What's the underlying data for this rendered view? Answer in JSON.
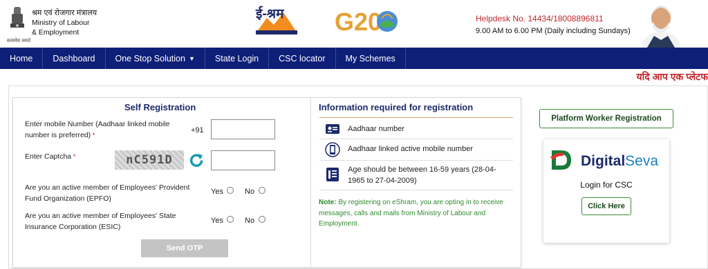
{
  "header": {
    "ministry_hindi": "श्रम एवं रोजगार मंत्रालय",
    "ministry_line1": "Ministry of Labour",
    "ministry_line2": "& Employment",
    "emblem_caption": "सत्यमेव जयते",
    "eshram_text": "ई-श्रम",
    "g20_text": "G20",
    "helpdesk": "Helpdesk No. 14434/18008896811",
    "hours": "9.00 AM to 6.00 PM (Daily including Sundays)"
  },
  "nav": {
    "items": [
      {
        "label": "Home"
      },
      {
        "label": "Dashboard"
      },
      {
        "label": "One Stop Solution",
        "has_caret": true
      },
      {
        "label": "State Login"
      },
      {
        "label": "CSC locator"
      },
      {
        "label": "My Schemes"
      }
    ]
  },
  "marquee": "यदि आप एक प्लेटफ",
  "self_registration": {
    "title": "Self Registration",
    "mobile_label": "Enter mobile Number (Aadhaar linked mobile number is preferred)",
    "mobile_prefix": "+91",
    "mobile_value": "",
    "captcha_label": "Enter Captcha",
    "captcha_text": "nC591D",
    "captcha_value": "",
    "epfo_question": "Are you an active member of Employees' Provident Fund Organization (EPFO)",
    "esic_question": "Are you an active member of Employees' State Insurance Corporation (ESIC)",
    "yes_label": "Yes",
    "no_label": "No",
    "send_otp": "Send OTP"
  },
  "info": {
    "title": "Information required for registration",
    "items": [
      {
        "icon": "id-card-icon",
        "text": "Aadhaar number"
      },
      {
        "icon": "mobile-phone-icon",
        "text": "Aadhaar linked active mobile number"
      },
      {
        "icon": "document-icon",
        "text": "Age should be between 16-59 years (28-04-1965 to 27-04-2009)"
      }
    ],
    "note_label": "Note:",
    "note_text": "By registering on eShram, you are opting in to receive messages, calls and mails from Ministry of Labour and Employment."
  },
  "right": {
    "platform_worker_button": "Platform Worker Registration",
    "digital": "Digital",
    "seva": "Seva",
    "login_for_csc": "Login for CSC",
    "click_here": "Click Here"
  },
  "colors": {
    "nav_bg": "#0e1f78",
    "title_blue": "#1c2a6b",
    "helpdesk_red": "#c0282d",
    "note_green": "#2e8b2e"
  }
}
